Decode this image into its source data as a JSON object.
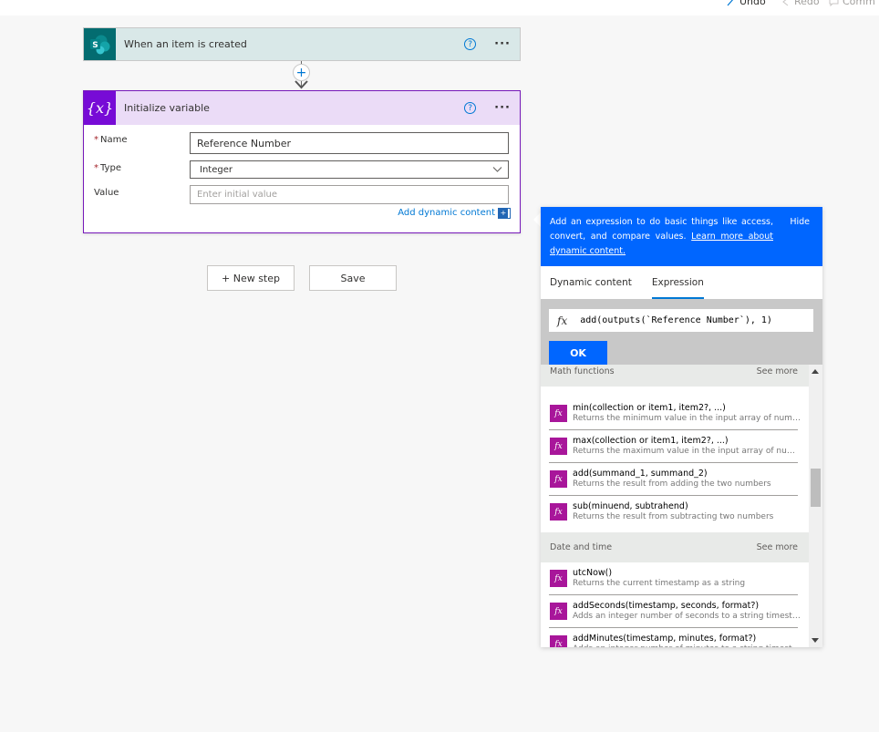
{
  "commandbar": {
    "undo_label": "Undo",
    "redo_label": "Redo",
    "comments_label": "Comm"
  },
  "trigger": {
    "title": "When an item is created",
    "icon": "sharepoint-icon",
    "icon_letter": "S",
    "help": "?",
    "more": "···"
  },
  "action": {
    "title": "Initialize variable",
    "icon": "variable-icon",
    "icon_text": "{x}",
    "help": "?",
    "more": "···",
    "fields": {
      "name_label": "Name",
      "name_value": "Reference Number",
      "type_label": "Type",
      "type_value": "Integer",
      "value_label": "Value",
      "value_placeholder": "Enter initial value",
      "required_mark": "*"
    },
    "add_dynamic_label": "Add dynamic content",
    "add_dynamic_icon": "+"
  },
  "buttons": {
    "new_step": "+ New step",
    "save": "Save"
  },
  "panel": {
    "info_text": "Add an expression to do basic things like access, convert, and compare values.",
    "info_link": "Learn more about dynamic content.",
    "hide_label": "Hide",
    "tabs": [
      {
        "label": "Dynamic content",
        "active": false
      },
      {
        "label": "Expression",
        "active": true
      }
    ],
    "fx_symbol": "fx",
    "expression": "add(outputs(`Reference Number`), 1)",
    "ok_label": "OK",
    "sections": [
      {
        "title": "Math functions",
        "see_more": "See more",
        "items": [
          {
            "name": "min(collection or item1, item2?, ...)",
            "desc": "Returns the minimum value in the input array of numbers"
          },
          {
            "name": "max(collection or item1, item2?, ...)",
            "desc": "Returns the maximum value in the input array of numbers"
          },
          {
            "name": "add(summand_1, summand_2)",
            "desc": "Returns the result from adding the two numbers"
          },
          {
            "name": "sub(minuend, subtrahend)",
            "desc": "Returns the result from subtracting two numbers"
          }
        ]
      },
      {
        "title": "Date and time",
        "see_more": "See more",
        "items": [
          {
            "name": "utcNow()",
            "desc": "Returns the current timestamp as a string"
          },
          {
            "name": "addSeconds(timestamp, seconds, format?)",
            "desc": "Adds an integer number of seconds to a string timestam..."
          },
          {
            "name": "addMinutes(timestamp, minutes, format?)",
            "desc": "Adds an integer number of minutes to a string timestam..."
          }
        ]
      }
    ]
  },
  "colors": {
    "trigger_bg": "#d9e8e8",
    "sharepoint": "#036c70",
    "action_accent": "#770bd6",
    "action_header_bg": "#ebdcf7",
    "panel_blue": "#0066ff",
    "fx_icon": "#a8169a",
    "link": "#0078d4"
  }
}
